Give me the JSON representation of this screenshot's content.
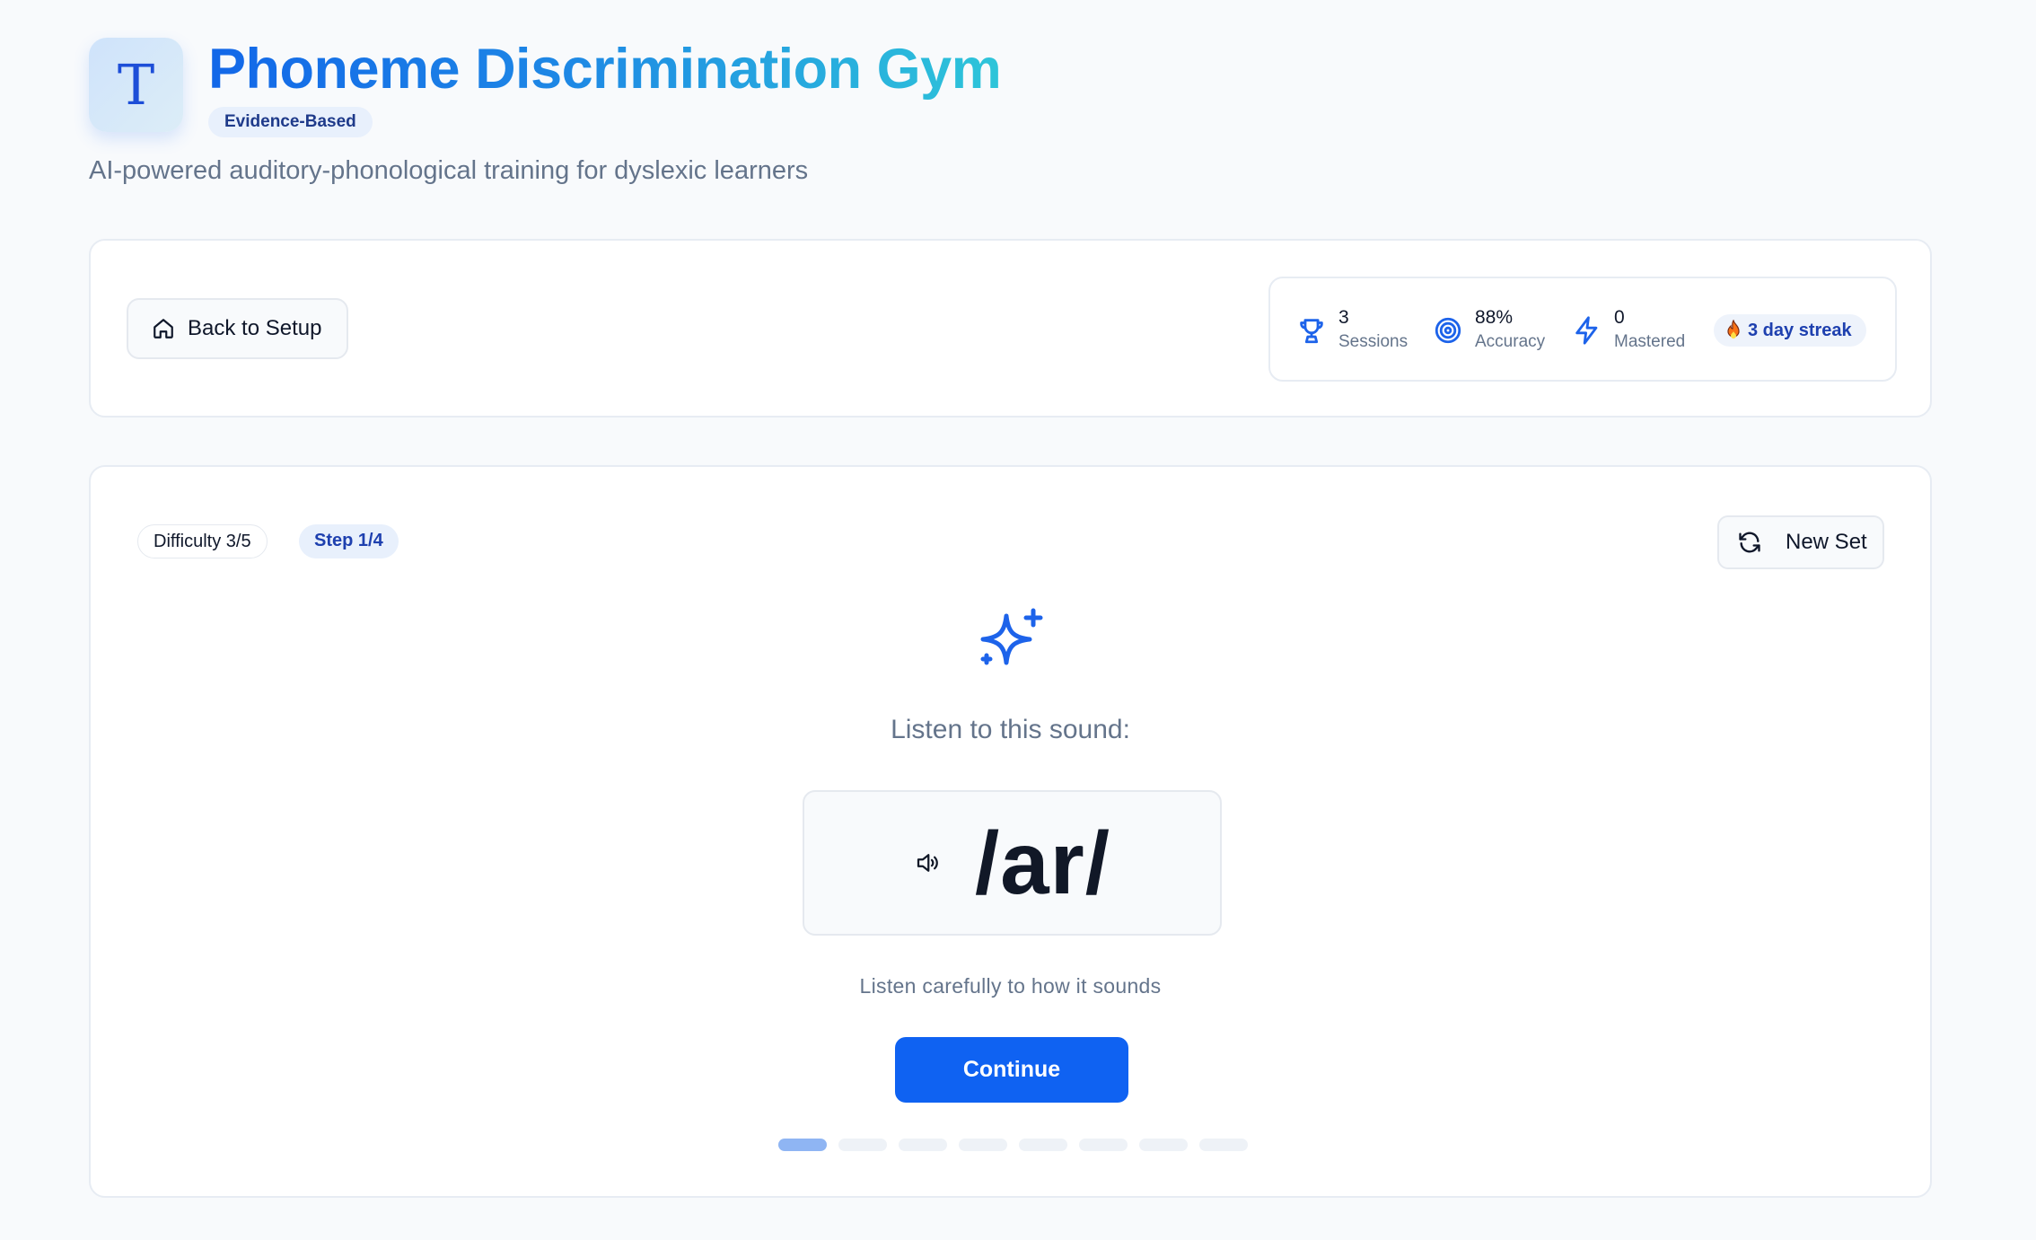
{
  "header": {
    "icon_letter": "T",
    "title": "Phoneme Discrimination Gym",
    "badge": "Evidence-Based",
    "subtitle": "AI-powered auditory-phonological training for dyslexic learners"
  },
  "toolbar": {
    "back_label": "Back to Setup",
    "stats": [
      {
        "value": "3",
        "label": "Sessions",
        "icon": "trophy-icon"
      },
      {
        "value": "88%",
        "label": "Accuracy",
        "icon": "target-icon"
      },
      {
        "value": "0",
        "label": "Mastered",
        "icon": "lightning-icon"
      }
    ],
    "streak": "3 day streak"
  },
  "exercise": {
    "difficulty": "Difficulty 3/5",
    "step": "Step 1/4",
    "new_set_label": "New Set",
    "prompt": "Listen to this sound:",
    "phoneme": "/ar/",
    "hint": "Listen carefully to how it sounds",
    "continue_label": "Continue",
    "progress_total": 8,
    "progress_current": 1
  },
  "colors": {
    "accent": "#0f62f2",
    "title_gradient_start": "#1267e8",
    "title_gradient_end": "#2ec5d9"
  }
}
